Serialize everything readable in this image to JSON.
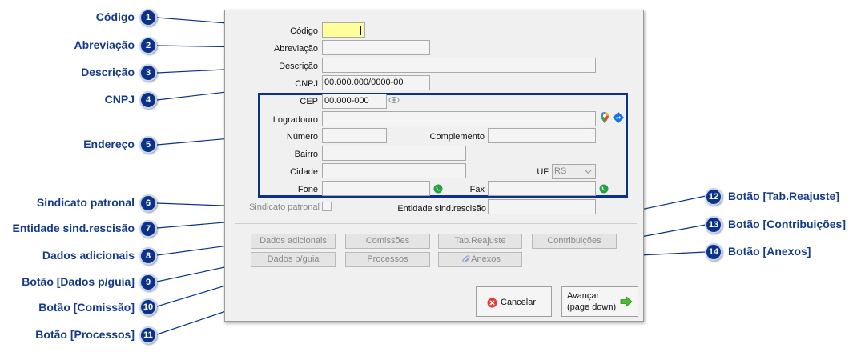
{
  "form": {
    "codigo_label": "Código",
    "codigo_value": "",
    "abreviacao_label": "Abreviação",
    "abreviacao_value": "",
    "descricao_label": "Descrição",
    "descricao_value": "",
    "cnpj_label": "CNPJ",
    "cnpj_value": "00.000.000/0000-00",
    "cep_label": "CEP",
    "cep_value": "00.000-000",
    "logradouro_label": "Logradouro",
    "numero_label": "Número",
    "complemento_label": "Complemento",
    "bairro_label": "Bairro",
    "cidade_label": "Cidade",
    "uf_label": "UF",
    "uf_value": "RS",
    "fone_label": "Fone",
    "fax_label": "Fax",
    "sindicato_label": "Sindicato patronal",
    "entidade_label": "Entidade sind.rescisão",
    "entidade_value": ""
  },
  "buttons": {
    "dados_adicionais": "Dados adicionais",
    "comissoes": "Comissões",
    "tab_reajuste": "Tab.Reajuste",
    "contribuicoes": "Contribuições",
    "dados_guia": "Dados p/guia",
    "processos": "Processos",
    "anexos": "Anexos",
    "cancelar": "Cancelar",
    "avancar_line1": "Avançar",
    "avancar_line2": "(page down)"
  },
  "callouts": [
    {
      "num": "1",
      "text": "Código"
    },
    {
      "num": "2",
      "text": "Abreviação"
    },
    {
      "num": "3",
      "text": "Descrição"
    },
    {
      "num": "4",
      "text": "CNPJ"
    },
    {
      "num": "5",
      "text": "Endereço"
    },
    {
      "num": "6",
      "text": "Sindicato patronal"
    },
    {
      "num": "7",
      "text": "Entidade sind.rescisão"
    },
    {
      "num": "8",
      "text": "Dados adicionais"
    },
    {
      "num": "9",
      "text": "Botão [Dados p/guia]"
    },
    {
      "num": "10",
      "text": "Botão [Comissão]"
    },
    {
      "num": "11",
      "text": "Botão [Processos]"
    },
    {
      "num": "12",
      "text": "Botão [Tab.Reajuste]"
    },
    {
      "num": "13",
      "text": "Botão [Contribuições]"
    },
    {
      "num": "14",
      "text": "Botão [Anexos]"
    }
  ],
  "colors": {
    "callout_blue": "#0b3288",
    "callout_text": "#163a8a",
    "highlight_field": "#ffff99",
    "whatsapp_green": "#25a244"
  },
  "icons": [
    "map-pin-icon",
    "directions-icon",
    "whatsapp-icon",
    "eye-icon",
    "paperclip-icon",
    "cancel-icon",
    "arrow-right-icon"
  ]
}
